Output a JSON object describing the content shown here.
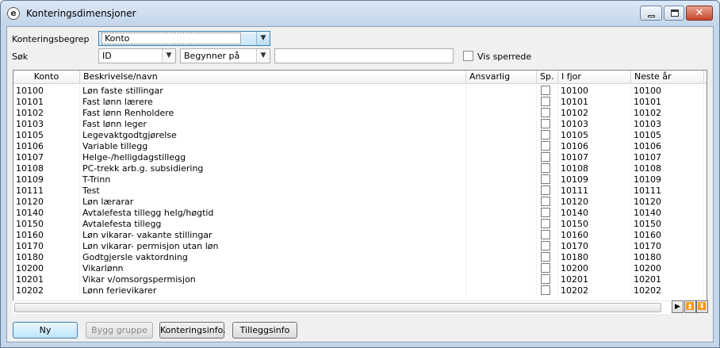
{
  "window": {
    "title": "Konteringsdimensjoner",
    "close_glyph": "✕"
  },
  "form": {
    "konteringsbegrep_label": "Konteringsbegrep",
    "konteringsbegrep_value": "Konto",
    "sok_label": "Søk",
    "search_field_value": "ID",
    "search_mode_value": "Begynner på",
    "search_text": "",
    "vis_sperrede_label": "Vis sperrede"
  },
  "grid": {
    "columns": [
      "Konto",
      "Beskrivelse/navn",
      "Ansvarlig",
      "Sp.",
      "I fjor",
      "Neste år"
    ],
    "rows": [
      {
        "konto": "10100",
        "beskrivelse": "Løn faste stillingar",
        "ansvarlig": "",
        "ifjor": "10100",
        "neste": "10100"
      },
      {
        "konto": "10101",
        "beskrivelse": "Fast lønn lærere",
        "ansvarlig": "",
        "ifjor": "10101",
        "neste": "10101"
      },
      {
        "konto": "10102",
        "beskrivelse": "Fast lønn Renholdere",
        "ansvarlig": "",
        "ifjor": "10102",
        "neste": "10102"
      },
      {
        "konto": "10103",
        "beskrivelse": "Fast lønn leger",
        "ansvarlig": "",
        "ifjor": "10103",
        "neste": "10103"
      },
      {
        "konto": "10105",
        "beskrivelse": "Legevaktgodtgjørelse",
        "ansvarlig": "",
        "ifjor": "10105",
        "neste": "10105"
      },
      {
        "konto": "10106",
        "beskrivelse": "Variable tillegg",
        "ansvarlig": "",
        "ifjor": "10106",
        "neste": "10106"
      },
      {
        "konto": "10107",
        "beskrivelse": "Helge-/helligdagstillegg",
        "ansvarlig": "",
        "ifjor": "10107",
        "neste": "10107"
      },
      {
        "konto": "10108",
        "beskrivelse": "PC-trekk arb.g. subsidiering",
        "ansvarlig": "",
        "ifjor": "10108",
        "neste": "10108"
      },
      {
        "konto": "10109",
        "beskrivelse": "T-Trinn",
        "ansvarlig": "",
        "ifjor": "10109",
        "neste": "10109"
      },
      {
        "konto": "10111",
        "beskrivelse": "Test",
        "ansvarlig": "",
        "ifjor": "10111",
        "neste": "10111"
      },
      {
        "konto": "10120",
        "beskrivelse": "Løn lærarar",
        "ansvarlig": "",
        "ifjor": "10120",
        "neste": "10120"
      },
      {
        "konto": "10140",
        "beskrivelse": "Avtalefesta tillegg helg/høgtid",
        "ansvarlig": "",
        "ifjor": "10140",
        "neste": "10140"
      },
      {
        "konto": "10150",
        "beskrivelse": "Avtalefesta tillegg",
        "ansvarlig": "",
        "ifjor": "10150",
        "neste": "10150"
      },
      {
        "konto": "10160",
        "beskrivelse": "Løn vikarar- vakante stillingar",
        "ansvarlig": "",
        "ifjor": "10160",
        "neste": "10160"
      },
      {
        "konto": "10170",
        "beskrivelse": "Løn vikarar- permisjon utan løn",
        "ansvarlig": "",
        "ifjor": "10170",
        "neste": "10170"
      },
      {
        "konto": "10180",
        "beskrivelse": "Godtgjersle vaktordning",
        "ansvarlig": "",
        "ifjor": "10180",
        "neste": "10180"
      },
      {
        "konto": "10200",
        "beskrivelse": "Vikarlønn",
        "ansvarlig": "",
        "ifjor": "10200",
        "neste": "10200"
      },
      {
        "konto": "10201",
        "beskrivelse": "Vikar v/omsorgspermisjon",
        "ansvarlig": "",
        "ifjor": "10201",
        "neste": "10201"
      },
      {
        "konto": "10202",
        "beskrivelse": "Lønn ferievikarer",
        "ansvarlig": "",
        "ifjor": "10202",
        "neste": "10202"
      }
    ]
  },
  "buttons": {
    "ny": "Ny",
    "bygg_gruppe": "Bygg gruppe",
    "konteringsinfo": "Konteringsinfo.",
    "tilleggsinfo": "Tilleggsinfo"
  },
  "icons": {
    "app": "e",
    "dropdown": "▼",
    "scroll_right": "▶",
    "scroll_top": "⏫",
    "scroll_bottom": "⏬"
  }
}
